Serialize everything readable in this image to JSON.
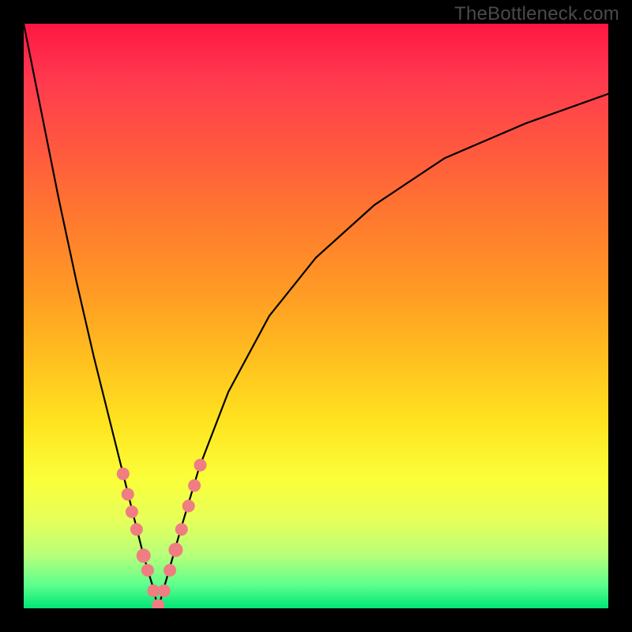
{
  "attribution": "TheBottleneck.com",
  "colors": {
    "top": "#ff1744",
    "bottom": "#00e676",
    "curve": "#000000",
    "dot": "#ef7d82",
    "frame": "#000000"
  },
  "chart_data": {
    "type": "line",
    "title": "",
    "xlabel": "",
    "ylabel": "",
    "xlim": [
      0,
      100
    ],
    "ylim": [
      0,
      100
    ],
    "notes": "V-shaped bottleneck curve on rainbow gradient; minimum near x≈23; salmon dots cluster along both legs near the trough.",
    "series": [
      {
        "name": "left-leg",
        "x": [
          0,
          3,
          6,
          9,
          12,
          15,
          17,
          19,
          20.5,
          22,
          23
        ],
        "y": [
          100,
          85,
          70,
          56,
          43,
          31,
          23,
          15,
          9,
          4,
          0
        ]
      },
      {
        "name": "right-leg",
        "x": [
          23,
          25,
          27,
          30,
          35,
          42,
          50,
          60,
          72,
          86,
          100
        ],
        "y": [
          0,
          7,
          14,
          24,
          37,
          50,
          60,
          69,
          77,
          83,
          88
        ]
      }
    ],
    "points": [
      {
        "x": 17.0,
        "y": 23.0,
        "r": 8
      },
      {
        "x": 17.8,
        "y": 19.5,
        "r": 8
      },
      {
        "x": 18.5,
        "y": 16.5,
        "r": 8
      },
      {
        "x": 19.3,
        "y": 13.5,
        "r": 8
      },
      {
        "x": 20.5,
        "y": 9.0,
        "r": 9
      },
      {
        "x": 21.2,
        "y": 6.5,
        "r": 8
      },
      {
        "x": 22.2,
        "y": 3.0,
        "r": 8
      },
      {
        "x": 23.0,
        "y": 0.5,
        "r": 8
      },
      {
        "x": 24.0,
        "y": 3.0,
        "r": 8
      },
      {
        "x": 25.0,
        "y": 6.5,
        "r": 8
      },
      {
        "x": 26.0,
        "y": 10.0,
        "r": 9
      },
      {
        "x": 27.0,
        "y": 13.5,
        "r": 8
      },
      {
        "x": 28.2,
        "y": 17.5,
        "r": 8
      },
      {
        "x": 29.2,
        "y": 21.0,
        "r": 8
      },
      {
        "x": 30.2,
        "y": 24.5,
        "r": 8
      }
    ]
  }
}
